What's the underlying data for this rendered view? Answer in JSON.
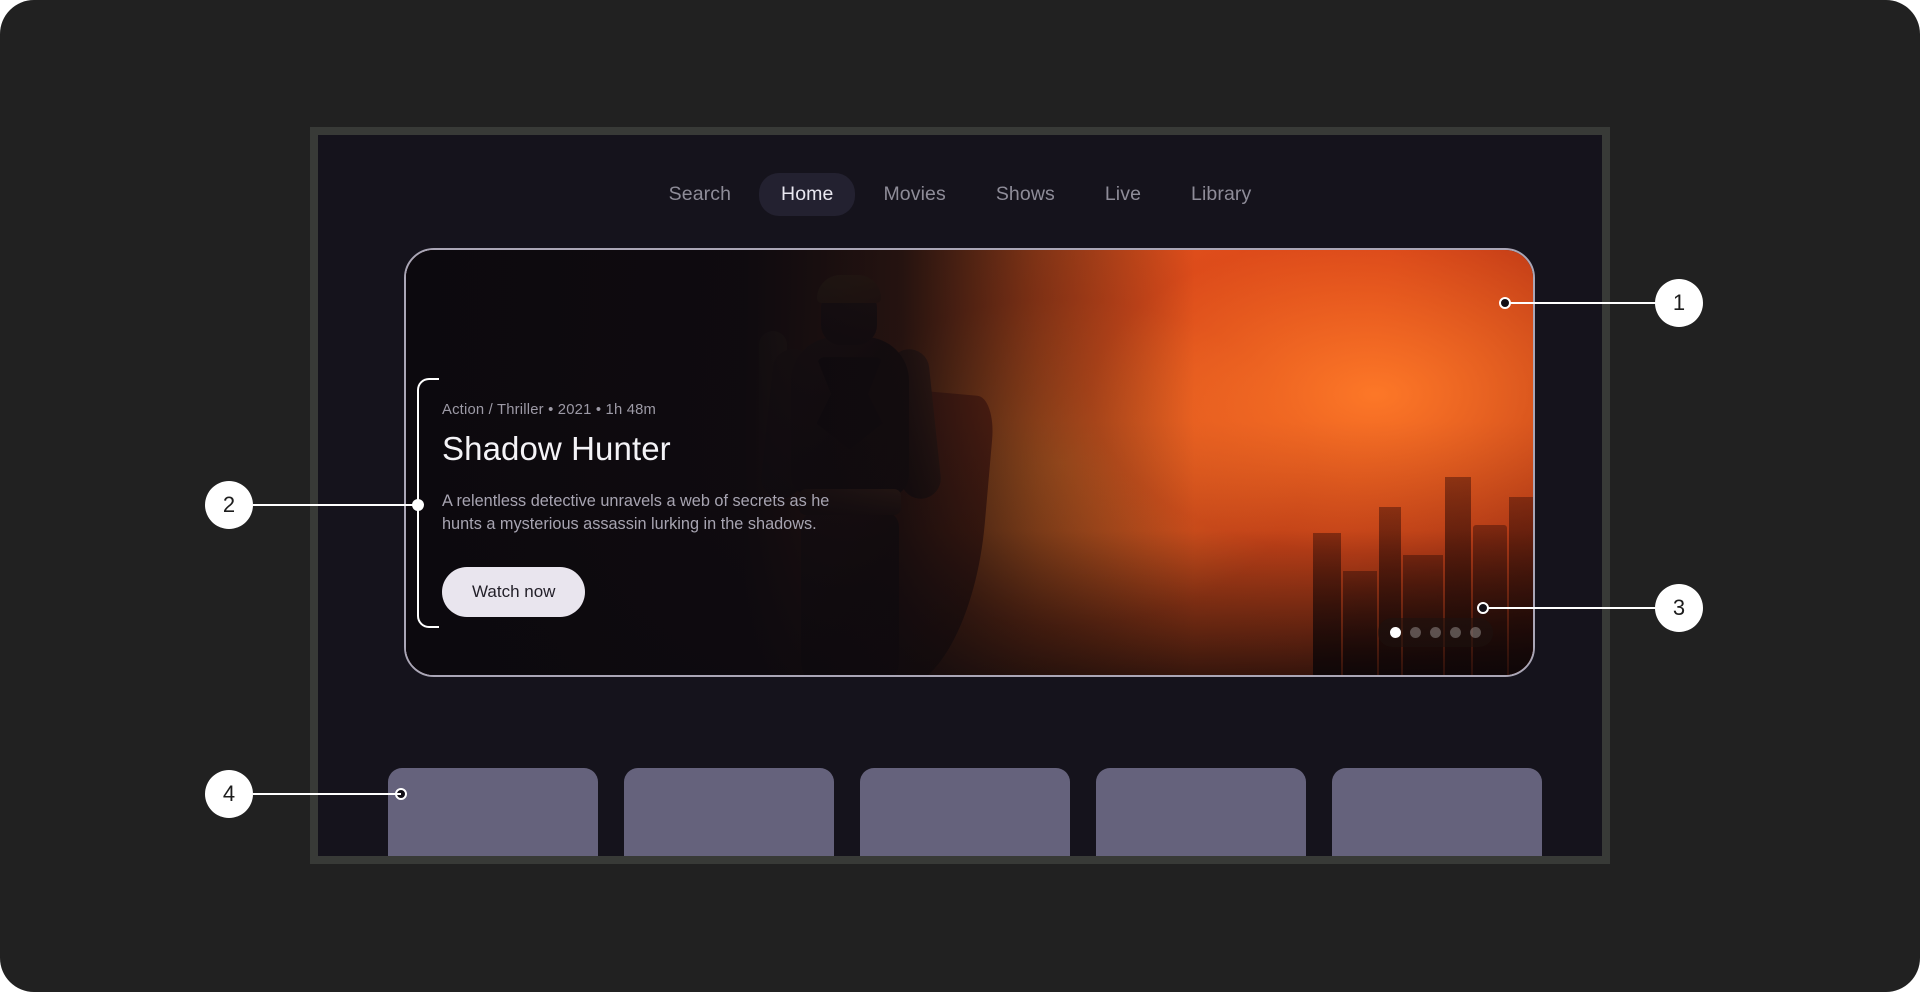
{
  "app": {
    "screen_background": "#15131c",
    "frame_color": "#383a37",
    "page_background": "#212121"
  },
  "nav": {
    "items": [
      {
        "label": "Search",
        "active": false
      },
      {
        "label": "Home",
        "active": true
      },
      {
        "label": "Movies",
        "active": false
      },
      {
        "label": "Shows",
        "active": false
      },
      {
        "label": "Live",
        "active": false
      },
      {
        "label": "Library",
        "active": false
      }
    ],
    "active_pill_color": "#232130",
    "active_text_color": "#e9e7f0",
    "inactive_text_color": "#8e8c98"
  },
  "hero": {
    "meta": "Action / Thriller • 2021 • 1h 48m",
    "title": "Shadow Hunter",
    "description": "A relentless detective unravels a web of secrets as he hunts a mysterious assassin lurking in the shadows.",
    "cta_label": "Watch now",
    "cta_background": "#e9e5ee",
    "cta_text_color": "#221f28",
    "border_color": "#aaa6b6",
    "artwork_accent": "#e2561d"
  },
  "pagination": {
    "total": 5,
    "active_index": 0,
    "active_dot_color": "#ffffff",
    "inactive_dot_color": "rgba(255,255,255,0.28)"
  },
  "carousel": {
    "card_color": "#65627c",
    "cards": [
      {
        "id": "card-1"
      },
      {
        "id": "card-2"
      },
      {
        "id": "card-3"
      },
      {
        "id": "card-4"
      },
      {
        "id": "card-5"
      }
    ]
  },
  "callouts": [
    {
      "number": "1",
      "target": "hero-card-border"
    },
    {
      "number": "2",
      "target": "hero-text-block"
    },
    {
      "number": "3",
      "target": "pagination-dots"
    },
    {
      "number": "4",
      "target": "carousel-card"
    }
  ]
}
